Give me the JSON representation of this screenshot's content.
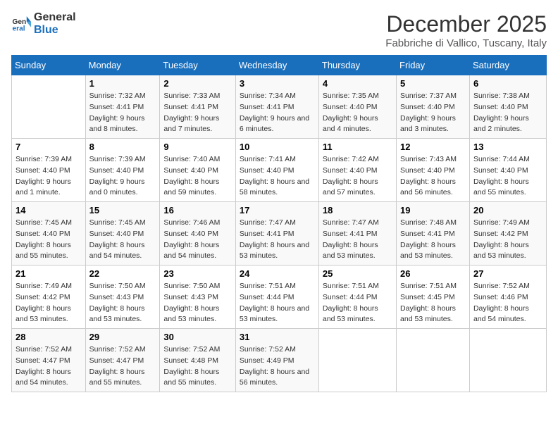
{
  "logo": {
    "general": "General",
    "blue": "Blue"
  },
  "title": "December 2025",
  "subtitle": "Fabbriche di Vallico, Tuscany, Italy",
  "days_of_week": [
    "Sunday",
    "Monday",
    "Tuesday",
    "Wednesday",
    "Thursday",
    "Friday",
    "Saturday"
  ],
  "weeks": [
    [
      {
        "day": "",
        "sunrise": "",
        "sunset": "",
        "daylight": ""
      },
      {
        "day": "1",
        "sunrise": "Sunrise: 7:32 AM",
        "sunset": "Sunset: 4:41 PM",
        "daylight": "Daylight: 9 hours and 8 minutes."
      },
      {
        "day": "2",
        "sunrise": "Sunrise: 7:33 AM",
        "sunset": "Sunset: 4:41 PM",
        "daylight": "Daylight: 9 hours and 7 minutes."
      },
      {
        "day": "3",
        "sunrise": "Sunrise: 7:34 AM",
        "sunset": "Sunset: 4:41 PM",
        "daylight": "Daylight: 9 hours and 6 minutes."
      },
      {
        "day": "4",
        "sunrise": "Sunrise: 7:35 AM",
        "sunset": "Sunset: 4:40 PM",
        "daylight": "Daylight: 9 hours and 4 minutes."
      },
      {
        "day": "5",
        "sunrise": "Sunrise: 7:37 AM",
        "sunset": "Sunset: 4:40 PM",
        "daylight": "Daylight: 9 hours and 3 minutes."
      },
      {
        "day": "6",
        "sunrise": "Sunrise: 7:38 AM",
        "sunset": "Sunset: 4:40 PM",
        "daylight": "Daylight: 9 hours and 2 minutes."
      }
    ],
    [
      {
        "day": "7",
        "sunrise": "Sunrise: 7:39 AM",
        "sunset": "Sunset: 4:40 PM",
        "daylight": "Daylight: 9 hours and 1 minute."
      },
      {
        "day": "8",
        "sunrise": "Sunrise: 7:39 AM",
        "sunset": "Sunset: 4:40 PM",
        "daylight": "Daylight: 9 hours and 0 minutes."
      },
      {
        "day": "9",
        "sunrise": "Sunrise: 7:40 AM",
        "sunset": "Sunset: 4:40 PM",
        "daylight": "Daylight: 8 hours and 59 minutes."
      },
      {
        "day": "10",
        "sunrise": "Sunrise: 7:41 AM",
        "sunset": "Sunset: 4:40 PM",
        "daylight": "Daylight: 8 hours and 58 minutes."
      },
      {
        "day": "11",
        "sunrise": "Sunrise: 7:42 AM",
        "sunset": "Sunset: 4:40 PM",
        "daylight": "Daylight: 8 hours and 57 minutes."
      },
      {
        "day": "12",
        "sunrise": "Sunrise: 7:43 AM",
        "sunset": "Sunset: 4:40 PM",
        "daylight": "Daylight: 8 hours and 56 minutes."
      },
      {
        "day": "13",
        "sunrise": "Sunrise: 7:44 AM",
        "sunset": "Sunset: 4:40 PM",
        "daylight": "Daylight: 8 hours and 55 minutes."
      }
    ],
    [
      {
        "day": "14",
        "sunrise": "Sunrise: 7:45 AM",
        "sunset": "Sunset: 4:40 PM",
        "daylight": "Daylight: 8 hours and 55 minutes."
      },
      {
        "day": "15",
        "sunrise": "Sunrise: 7:45 AM",
        "sunset": "Sunset: 4:40 PM",
        "daylight": "Daylight: 8 hours and 54 minutes."
      },
      {
        "day": "16",
        "sunrise": "Sunrise: 7:46 AM",
        "sunset": "Sunset: 4:40 PM",
        "daylight": "Daylight: 8 hours and 54 minutes."
      },
      {
        "day": "17",
        "sunrise": "Sunrise: 7:47 AM",
        "sunset": "Sunset: 4:41 PM",
        "daylight": "Daylight: 8 hours and 53 minutes."
      },
      {
        "day": "18",
        "sunrise": "Sunrise: 7:47 AM",
        "sunset": "Sunset: 4:41 PM",
        "daylight": "Daylight: 8 hours and 53 minutes."
      },
      {
        "day": "19",
        "sunrise": "Sunrise: 7:48 AM",
        "sunset": "Sunset: 4:41 PM",
        "daylight": "Daylight: 8 hours and 53 minutes."
      },
      {
        "day": "20",
        "sunrise": "Sunrise: 7:49 AM",
        "sunset": "Sunset: 4:42 PM",
        "daylight": "Daylight: 8 hours and 53 minutes."
      }
    ],
    [
      {
        "day": "21",
        "sunrise": "Sunrise: 7:49 AM",
        "sunset": "Sunset: 4:42 PM",
        "daylight": "Daylight: 8 hours and 53 minutes."
      },
      {
        "day": "22",
        "sunrise": "Sunrise: 7:50 AM",
        "sunset": "Sunset: 4:43 PM",
        "daylight": "Daylight: 8 hours and 53 minutes."
      },
      {
        "day": "23",
        "sunrise": "Sunrise: 7:50 AM",
        "sunset": "Sunset: 4:43 PM",
        "daylight": "Daylight: 8 hours and 53 minutes."
      },
      {
        "day": "24",
        "sunrise": "Sunrise: 7:51 AM",
        "sunset": "Sunset: 4:44 PM",
        "daylight": "Daylight: 8 hours and 53 minutes."
      },
      {
        "day": "25",
        "sunrise": "Sunrise: 7:51 AM",
        "sunset": "Sunset: 4:44 PM",
        "daylight": "Daylight: 8 hours and 53 minutes."
      },
      {
        "day": "26",
        "sunrise": "Sunrise: 7:51 AM",
        "sunset": "Sunset: 4:45 PM",
        "daylight": "Daylight: 8 hours and 53 minutes."
      },
      {
        "day": "27",
        "sunrise": "Sunrise: 7:52 AM",
        "sunset": "Sunset: 4:46 PM",
        "daylight": "Daylight: 8 hours and 54 minutes."
      }
    ],
    [
      {
        "day": "28",
        "sunrise": "Sunrise: 7:52 AM",
        "sunset": "Sunset: 4:47 PM",
        "daylight": "Daylight: 8 hours and 54 minutes."
      },
      {
        "day": "29",
        "sunrise": "Sunrise: 7:52 AM",
        "sunset": "Sunset: 4:47 PM",
        "daylight": "Daylight: 8 hours and 55 minutes."
      },
      {
        "day": "30",
        "sunrise": "Sunrise: 7:52 AM",
        "sunset": "Sunset: 4:48 PM",
        "daylight": "Daylight: 8 hours and 55 minutes."
      },
      {
        "day": "31",
        "sunrise": "Sunrise: 7:52 AM",
        "sunset": "Sunset: 4:49 PM",
        "daylight": "Daylight: 8 hours and 56 minutes."
      },
      {
        "day": "",
        "sunrise": "",
        "sunset": "",
        "daylight": ""
      },
      {
        "day": "",
        "sunrise": "",
        "sunset": "",
        "daylight": ""
      },
      {
        "day": "",
        "sunrise": "",
        "sunset": "",
        "daylight": ""
      }
    ]
  ]
}
